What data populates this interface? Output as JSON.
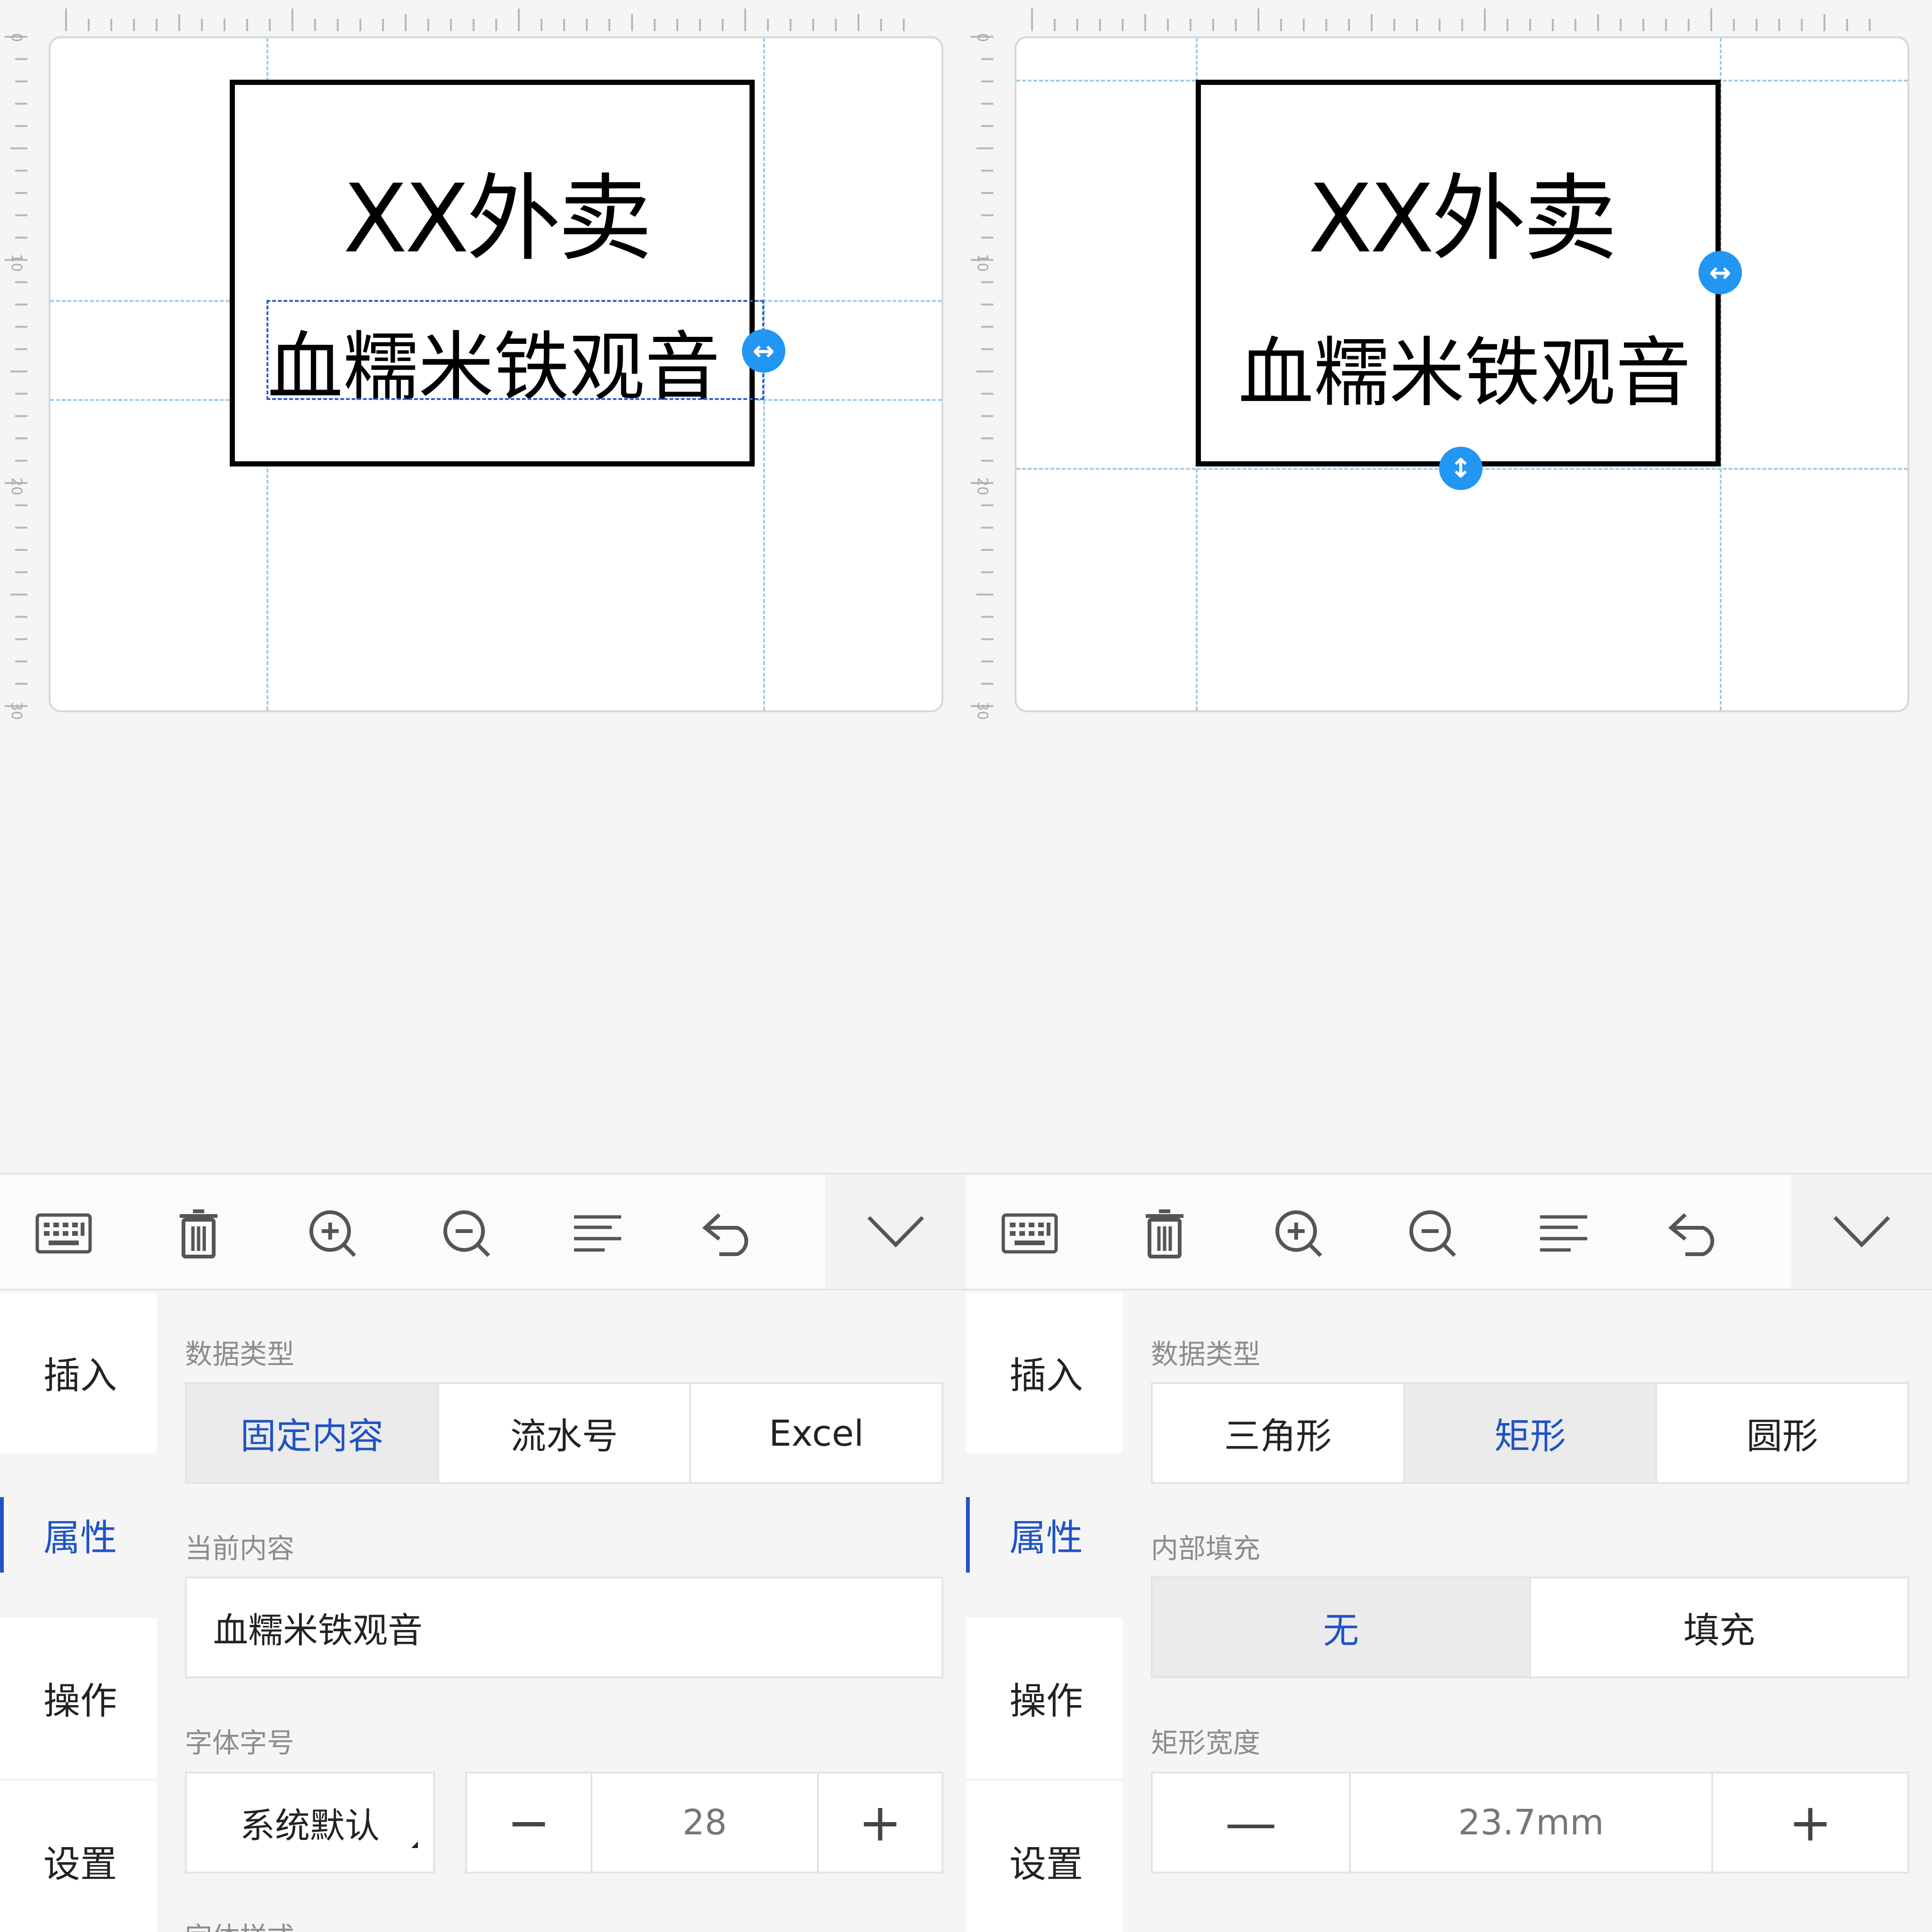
{
  "ruler": {
    "ticks": [
      "0",
      "10",
      "20",
      "30"
    ]
  },
  "label": {
    "title": "XX外卖",
    "subtitle": "血糯米铁观音"
  },
  "toolbar": {
    "icons": [
      "keyboard-icon",
      "trash-icon",
      "zoom-in-icon",
      "zoom-out-icon",
      "align-icon",
      "undo-icon",
      "chevron-down-icon"
    ]
  },
  "nav": {
    "items": [
      {
        "label": "插入"
      },
      {
        "label": "属性"
      },
      {
        "label": "操作"
      },
      {
        "label": "设置"
      }
    ],
    "active": "属性"
  },
  "left_panel": {
    "data_type_label": "数据类型",
    "data_types": [
      "固定内容",
      "流水号",
      "Excel"
    ],
    "data_type_selected": "固定内容",
    "current_content_label": "当前内容",
    "current_content_value": "血糯米铁观音",
    "font_label": "字体字号",
    "font_family": "系统默认",
    "font_size": "28",
    "minus": "−",
    "plus": "+",
    "font_style_label": "字体样式"
  },
  "right_panel": {
    "data_type_label": "数据类型",
    "shapes": [
      "三角形",
      "矩形",
      "圆形"
    ],
    "shape_selected": "矩形",
    "fill_label": "内部填充",
    "fills": [
      "无",
      "填充"
    ],
    "fill_selected": "无",
    "width_label": "矩形宽度",
    "width_value": "23.7mm",
    "minus": "—",
    "plus": "+"
  },
  "colors": {
    "accent": "#1f53c4",
    "handle": "#2196f3",
    "guide": "#9fcde8"
  }
}
